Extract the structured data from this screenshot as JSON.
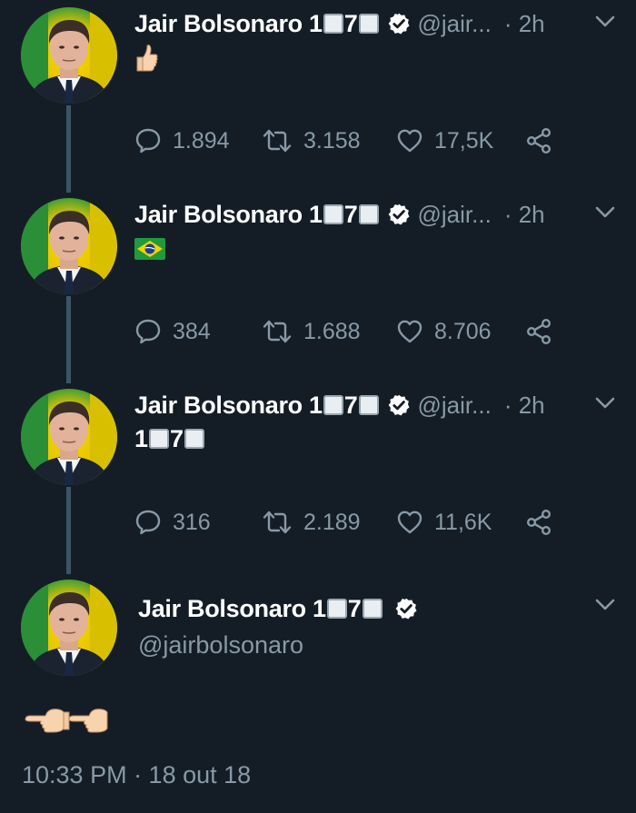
{
  "colors": {
    "background": "#141d26",
    "primary_text": "#ffffff",
    "secondary_text": "#8899a6",
    "thread_line": "#3d5466"
  },
  "tweets": [
    {
      "name": "Jair Bolsonaro 1⬜7⬜",
      "handle": "@jair...",
      "time": "· 2h",
      "content_emoji": "thumbs-up",
      "replies": "1.894",
      "retweets": "3.158",
      "likes": "17,5K"
    },
    {
      "name": "Jair Bolsonaro 1⬜7⬜",
      "handle": "@jair...",
      "time": "· 2h",
      "content_emoji": "brazil-flag",
      "replies": "384",
      "retweets": "1.688",
      "likes": "8.706"
    },
    {
      "name": "Jair Bolsonaro 1⬜7⬜",
      "handle": "@jair...",
      "time": "· 2h",
      "content_text": "1⬜7⬜",
      "replies": "316",
      "retweets": "2.189",
      "likes": "11,6K"
    }
  ],
  "main_tweet": {
    "name": "Jair Bolsonaro 1⬜7⬜",
    "handle": "@jairbolsonaro",
    "content_emoji": "two pointing-left hands",
    "timestamp": "10:33 PM · 18 out 18"
  },
  "icons": {
    "verified": "verified-badge-icon",
    "reply": "reply-icon",
    "retweet": "retweet-icon",
    "like": "heart-icon",
    "share": "share-icon",
    "menu": "chevron-down-icon"
  }
}
